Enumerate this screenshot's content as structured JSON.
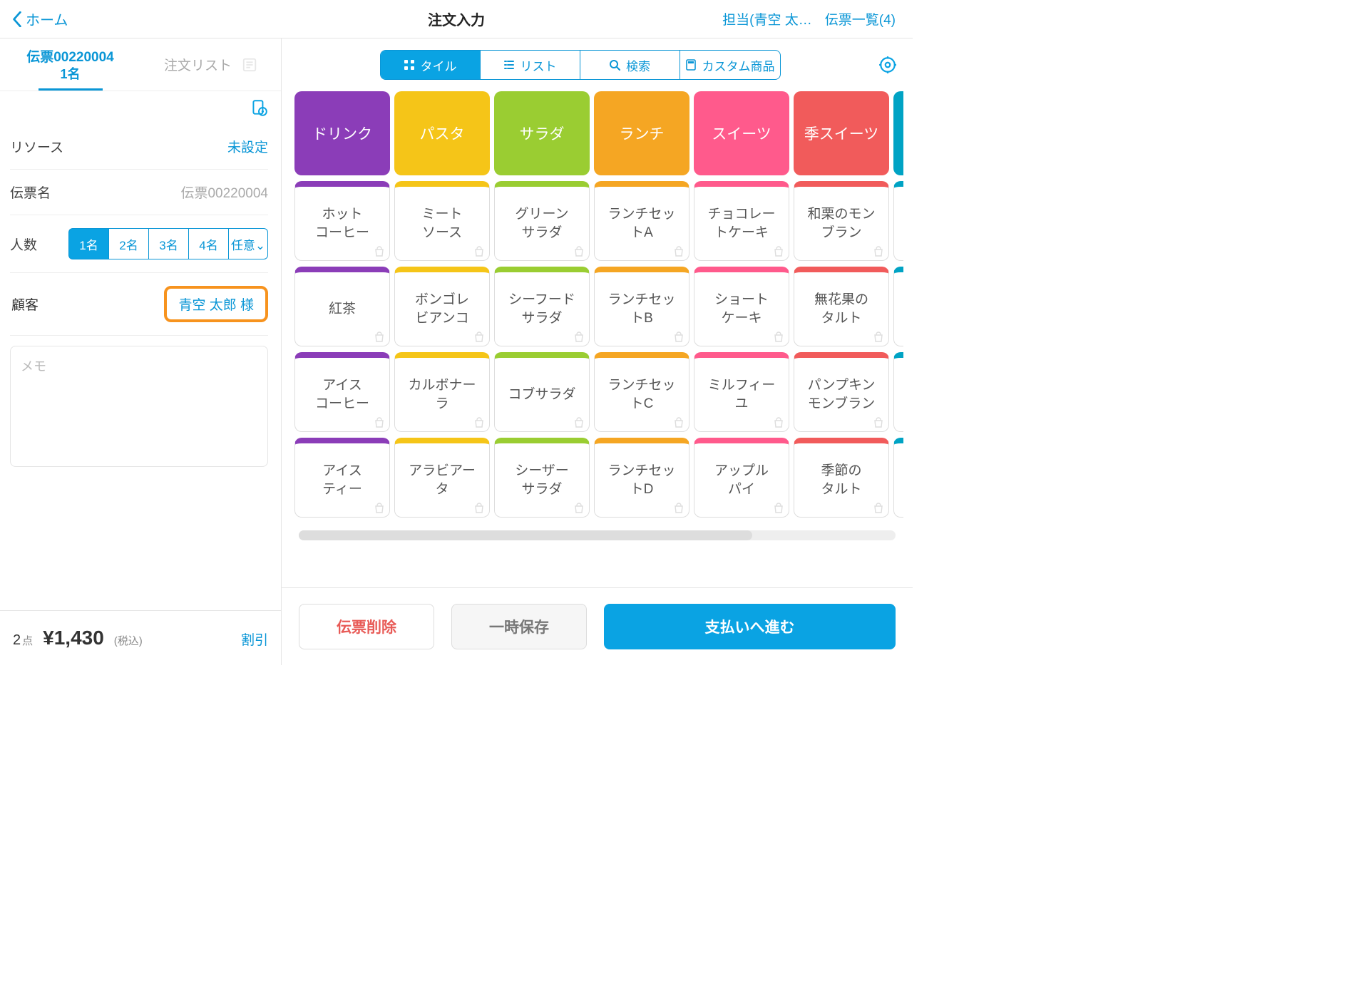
{
  "colors": {
    "purple": "#8b3db8",
    "yellow": "#f5c518",
    "green": "#9acd32",
    "orange": "#f5a623",
    "pink": "#ff5a8c",
    "red": "#f15b5b",
    "teal": "#00a3c4"
  },
  "top": {
    "back": "ホーム",
    "title": "注文入力",
    "staff": "担当(青空 太…",
    "slips": "伝票一覧(4)"
  },
  "sideTabs": {
    "slip": "伝票00220004",
    "people": "1名",
    "list": "注文リスト"
  },
  "rows": {
    "resource": {
      "lab": "リソース",
      "val": "未設定"
    },
    "slipName": {
      "lab": "伝票名",
      "val": "伝票00220004"
    },
    "people": {
      "lab": "人数",
      "opts": [
        "1名",
        "2名",
        "3名",
        "4名",
        "任意"
      ],
      "sel": 0,
      "caret": "⌄"
    },
    "customer": {
      "lab": "顧客",
      "val": "青空 太郎 様"
    }
  },
  "memoPlaceholder": "メモ",
  "sideFoot": {
    "points": "2",
    "ptsUnit": "点",
    "total": "¥1,430",
    "tax": "(税込)",
    "discount": "割引"
  },
  "seg": {
    "tile": "タイル",
    "list": "リスト",
    "search": "検索",
    "custom": "カスタム商品"
  },
  "cats": [
    {
      "name": "ドリンク",
      "color": "purple"
    },
    {
      "name": "パスタ",
      "color": "yellow"
    },
    {
      "name": "サラダ",
      "color": "green"
    },
    {
      "name": "ランチ",
      "color": "orange"
    },
    {
      "name": "スイーツ",
      "color": "pink"
    },
    {
      "name": "季スイーツ",
      "color": "red"
    },
    {
      "name": "",
      "color": "teal",
      "edge": true
    }
  ],
  "cols": [
    {
      "color": "purple",
      "items": [
        "ホット\nコーヒー",
        "紅茶",
        "アイス\nコーヒー",
        "アイス\nティー"
      ]
    },
    {
      "color": "yellow",
      "items": [
        "ミート\nソース",
        "ボンゴレ\nビアンコ",
        "カルボナー\nラ",
        "アラビアー\nタ"
      ]
    },
    {
      "color": "green",
      "items": [
        "グリーン\nサラダ",
        "シーフード\nサラダ",
        "コブサラダ",
        "シーザー\nサラダ"
      ]
    },
    {
      "color": "orange",
      "items": [
        "ランチセッ\nトA",
        "ランチセッ\nトB",
        "ランチセッ\nトC",
        "ランチセッ\nトD"
      ]
    },
    {
      "color": "pink",
      "items": [
        "チョコレー\nトケーキ",
        "ショート\nケーキ",
        "ミルフィー\nユ",
        "アップル\nパイ"
      ]
    },
    {
      "color": "red",
      "items": [
        "和栗のモン\nブラン",
        "無花果の\nタルト",
        "パンプキン\nモンブラン",
        "季節の\nタルト"
      ]
    },
    {
      "color": "teal",
      "edge": true,
      "items": [
        "",
        "",
        "",
        ""
      ]
    }
  ],
  "footer": {
    "del": "伝票削除",
    "save": "一時保存",
    "pay": "支払いへ進む"
  }
}
